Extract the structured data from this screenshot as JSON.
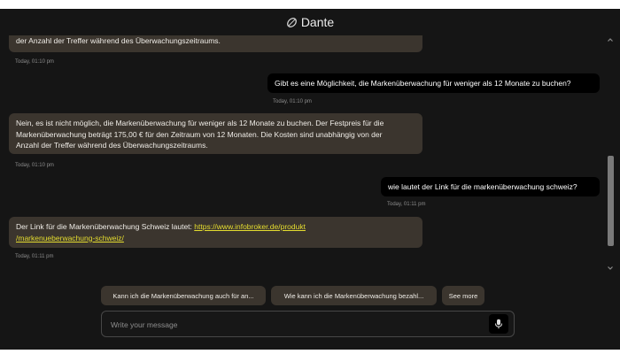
{
  "header": {
    "brand": "Dante",
    "logo_icon": "dante-leaf-icon"
  },
  "messages": [
    {
      "role": "bot",
      "lines": [
        "der Anzahl der Treffer während des Überwachungszeitraums."
      ],
      "time": "Today, 01:10 pm"
    },
    {
      "role": "user",
      "text": "Gibt es eine Möglichkeit, die Markenüberwachung für weniger als 12 Monate zu buchen?",
      "time": "Today, 01:10 pm"
    },
    {
      "role": "bot",
      "lines": [
        "Nein, es ist nicht möglich, die Markenüberwachung für weniger als 12 Monate zu buchen. Der Festpreis für die",
        "Markenüberwachung beträgt 175,00 € für den Zeitraum von 12 Monaten. Die Kosten sind unabhängig von der",
        "Anzahl der Treffer während des Überwachungszeitraums."
      ],
      "time": "Today, 01:10 pm"
    },
    {
      "role": "user",
      "text": "wie lautet der Link für die markenüberwachung schweiz?",
      "time": "Today, 01:11 pm"
    },
    {
      "role": "bot",
      "prefix": "Der Link für die Markenüberwachung Schweiz lautet: ",
      "link_line1": "https://www.infobroker.de/produkt",
      "link_line2": "/markenueberwachung-schweiz/",
      "time": "Today, 01:11 pm"
    }
  ],
  "suggestions": [
    "Kann ich die Markenüberwachung auch für an...",
    "Wie kann ich die Markenüberwachung bezahl...",
    "See more"
  ],
  "composer": {
    "placeholder": "Write your message",
    "mic_icon": "microphone-icon"
  },
  "colors": {
    "background": "#151515",
    "bot_bubble": "#3b352e",
    "user_bubble": "#000000",
    "link": "#e5dd2f"
  }
}
